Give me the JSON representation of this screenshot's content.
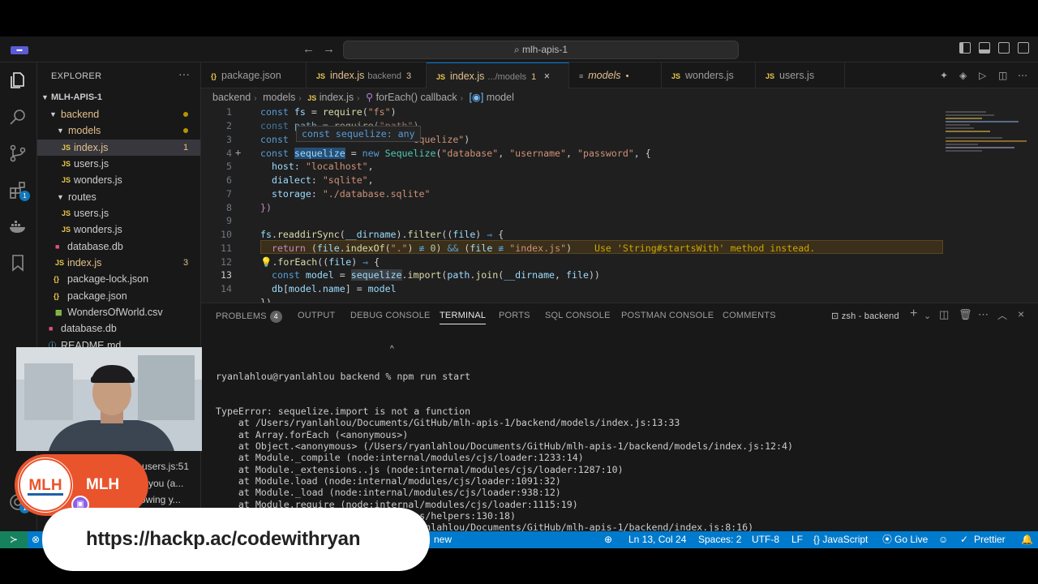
{
  "titlebar": {
    "search_text": "mlh-apis-1",
    "back_arrow": "←",
    "forward_arrow": "→"
  },
  "sidebar": {
    "title": "EXPLORER",
    "more": "···",
    "root": "MLH-APIS-1",
    "items": [
      {
        "label": "backend",
        "type": "folder",
        "decoration": "dot"
      },
      {
        "label": "models",
        "type": "folder",
        "decoration": "dot"
      },
      {
        "label": "index.js",
        "type": "js",
        "decoration": "1"
      },
      {
        "label": "users.js",
        "type": "js"
      },
      {
        "label": "wonders.js",
        "type": "js"
      },
      {
        "label": "routes",
        "type": "folder"
      },
      {
        "label": "users.js",
        "type": "js"
      },
      {
        "label": "wonders.js",
        "type": "js"
      },
      {
        "label": "database.db",
        "type": "db"
      },
      {
        "label": "index.js",
        "type": "js",
        "decoration": "3"
      },
      {
        "label": "package-lock.json",
        "type": "json"
      },
      {
        "label": "package.json",
        "type": "json"
      },
      {
        "label": "WondersOfWorld.csv",
        "type": "csv"
      },
      {
        "label": "database.db",
        "type": "db"
      },
      {
        "label": "README.md",
        "type": "md"
      }
    ],
    "partial_texts": [
      "users.js:51",
      "you (a...",
      "owing y..."
    ],
    "accounts_badge": "1"
  },
  "activity": {
    "extensions_badge": "1"
  },
  "tabs": [
    {
      "icon": "{}",
      "label": "package.json",
      "extra": "",
      "count": ""
    },
    {
      "icon": "JS",
      "label": "index.js",
      "extra": "backend",
      "count": "3"
    },
    {
      "icon": "JS",
      "label": "index.js",
      "extra": ".../models",
      "count": "1"
    },
    {
      "icon": "≡",
      "label": "models",
      "extra": "",
      "count": "•"
    },
    {
      "icon": "JS",
      "label": "wonders.js",
      "extra": "",
      "count": ""
    },
    {
      "icon": "JS",
      "label": "users.js",
      "extra": "",
      "count": ""
    }
  ],
  "breadcrumb": [
    "backend",
    "models",
    "index.js",
    "forEach() callback",
    "model"
  ],
  "editor": {
    "line_numbers": [
      "1",
      "2",
      "3",
      "4",
      "5",
      "6",
      "7",
      "8",
      "9",
      "10",
      "11",
      "12",
      "13",
      "14"
    ],
    "hover_text": "const sequelize: any",
    "warning_hint": "Use 'String#startsWith' method instead."
  },
  "panel": {
    "tabs": [
      "PROBLEMS",
      "OUTPUT",
      "DEBUG CONSOLE",
      "TERMINAL",
      "PORTS",
      "SQL CONSOLE",
      "POSTMAN CONSOLE",
      "COMMENTS"
    ],
    "problems_count": "4",
    "terminal_name": "zsh - backend",
    "prompt": "ryanlahlou@ryanlahlou backend % npm run start",
    "error_lines": [
      "TypeError: sequelize.import is not a function",
      "    at /Users/ryanlahlou/Documents/GitHub/mlh-apis-1/backend/models/index.js:13:33",
      "    at Array.forEach (<anonymous>)",
      "    at Object.<anonymous> (/Users/ryanlahlou/Documents/GitHub/mlh-apis-1/backend/models/index.js:12:4)",
      "    at Module._compile (node:internal/modules/cjs/loader:1233:14)",
      "    at Module._extensions..js (node:internal/modules/cjs/loader:1287:10)",
      "    at Module.load (node:internal/modules/cjs/loader:1091:32)",
      "    at Module._load (node:internal/modules/cjs/loader:938:12)",
      "    at Module.require (node:internal/modules/cjs/loader:1115:19)",
      "    at require (node:internal/modules/helpers:130:18)",
      "    at Object.<anonymous> (/Users/ryanlahlou/Documents/GitHub/mlh-apis-1/backend/index.js:8:16)"
    ]
  },
  "statusbar": {
    "remote": "≻",
    "new_text": "new",
    "position": "Ln 13, Col 24",
    "spaces": "Spaces: 2",
    "encoding": "UTF-8",
    "eol": "LF",
    "language": "{} JavaScript",
    "golive": "Go Live",
    "prettier": "Prettier"
  },
  "overlay": {
    "brand": "MLH",
    "logo_text": "MLH",
    "url": "https://hackp.ac/codewithryan"
  },
  "colors": {
    "statusbar": "#007acc",
    "mlh_orange": "#e9542c",
    "accent": "#0078d4"
  }
}
